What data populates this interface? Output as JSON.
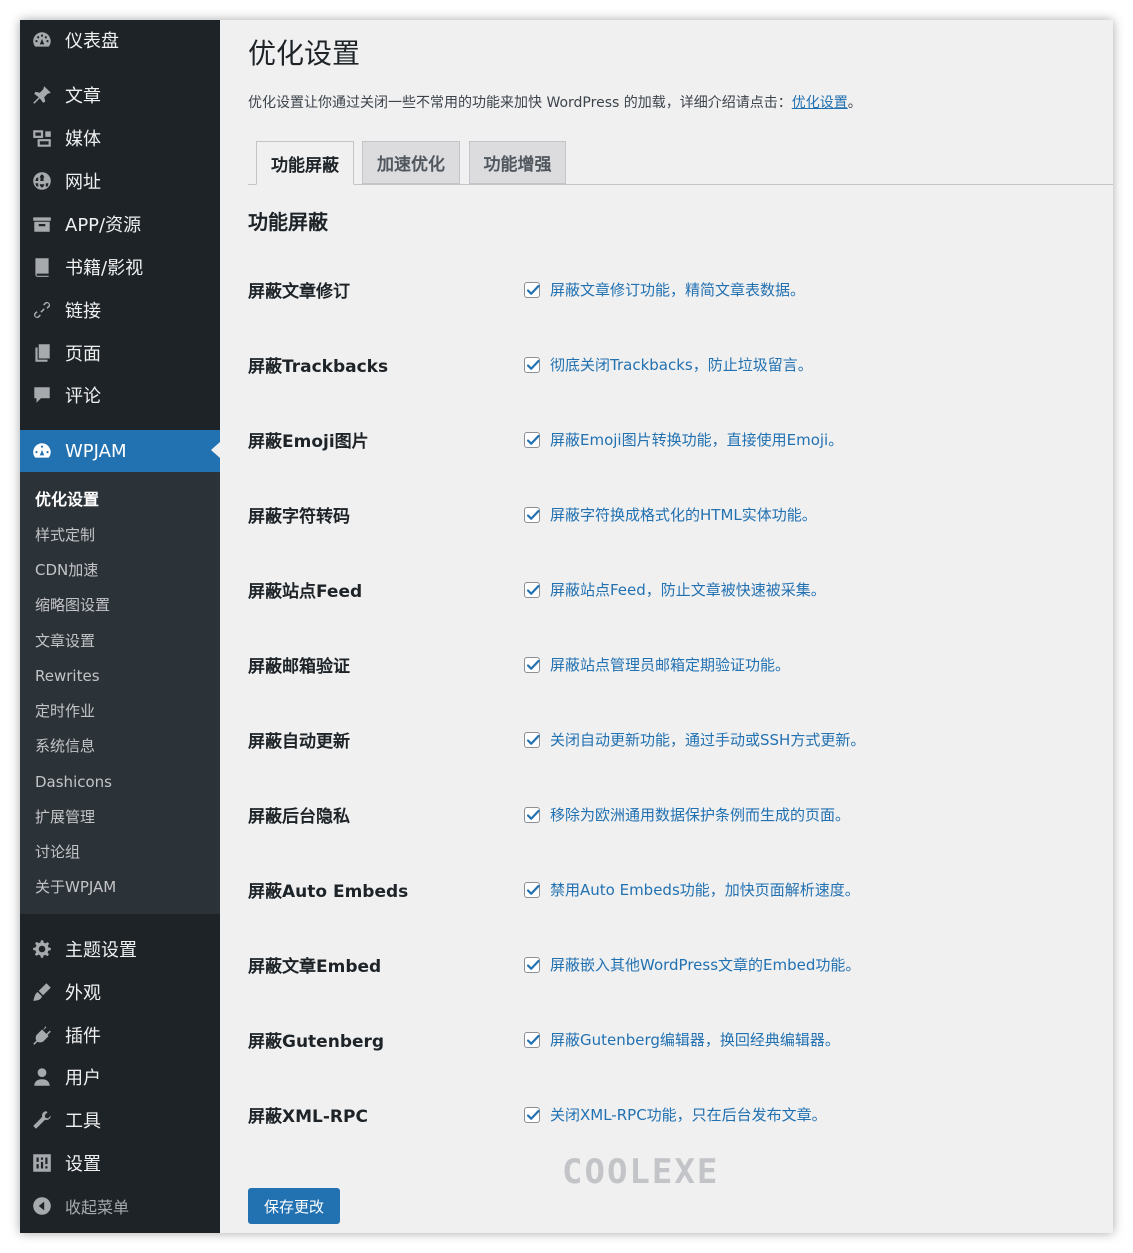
{
  "sidebar": {
    "items": [
      {
        "label": "仪表盘",
        "icon": "dashboard-icon"
      },
      {
        "label": "文章",
        "icon": "pin-icon"
      },
      {
        "label": "媒体",
        "icon": "media-icon"
      },
      {
        "label": "网址",
        "icon": "globe-icon"
      },
      {
        "label": "APP/资源",
        "icon": "archive-icon"
      },
      {
        "label": "书籍/影视",
        "icon": "book-icon"
      },
      {
        "label": "链接",
        "icon": "link-icon"
      },
      {
        "label": "页面",
        "icon": "page-icon"
      },
      {
        "label": "评论",
        "icon": "comment-icon"
      }
    ],
    "active": {
      "label": "WPJAM",
      "icon": "wpjam-gauge-icon"
    },
    "submenu": [
      "优化设置",
      "样式定制",
      "CDN加速",
      "缩略图设置",
      "文章设置",
      "Rewrites",
      "定时作业",
      "系统信息",
      "Dashicons",
      "扩展管理",
      "讨论组",
      "关于WPJAM"
    ],
    "bottom_items": [
      {
        "label": "主题设置",
        "icon": "gear-icon"
      },
      {
        "label": "外观",
        "icon": "brush-icon"
      },
      {
        "label": "插件",
        "icon": "plugin-icon"
      },
      {
        "label": "用户",
        "icon": "user-icon"
      },
      {
        "label": "工具",
        "icon": "wrench-icon"
      },
      {
        "label": "设置",
        "icon": "settings-icon"
      }
    ],
    "collapse_label": "收起菜单"
  },
  "main": {
    "title": "优化设置",
    "description": "优化设置让你通过关闭一些不常用的功能来加快 WordPress 的加载，详细介绍请点击：",
    "description_link": "优化设置",
    "description_end": "。",
    "tabs": [
      "功能屏蔽",
      "加速优化",
      "功能增强"
    ],
    "section_title": "功能屏蔽",
    "rows": [
      {
        "label": "屏蔽文章修订",
        "option": "屏蔽文章修订功能，精简文章表数据。",
        "checked": true
      },
      {
        "label": "屏蔽Trackbacks",
        "option": "彻底关闭Trackbacks，防止垃圾留言。",
        "checked": true
      },
      {
        "label": "屏蔽Emoji图片",
        "option": "屏蔽Emoji图片转换功能，直接使用Emoji。",
        "checked": true
      },
      {
        "label": "屏蔽字符转码",
        "option": "屏蔽字符换成格式化的HTML实体功能。",
        "checked": true
      },
      {
        "label": "屏蔽站点Feed",
        "option": "屏蔽站点Feed，防止文章被快速被采集。",
        "checked": true
      },
      {
        "label": "屏蔽邮箱验证",
        "option": "屏蔽站点管理员邮箱定期验证功能。",
        "checked": true
      },
      {
        "label": "屏蔽自动更新",
        "option": "关闭自动更新功能，通过手动或SSH方式更新。",
        "checked": true
      },
      {
        "label": "屏蔽后台隐私",
        "option": "移除为欧洲通用数据保护条例而生成的页面。",
        "checked": true
      },
      {
        "label": "屏蔽Auto Embeds",
        "option": "禁用Auto Embeds功能，加快页面解析速度。",
        "checked": true
      },
      {
        "label": "屏蔽文章Embed",
        "option": "屏蔽嵌入其他WordPress文章的Embed功能。",
        "checked": true
      },
      {
        "label": "屏蔽Gutenberg",
        "option": "屏蔽Gutenberg编辑器，换回经典编辑器。",
        "checked": true
      },
      {
        "label": "屏蔽XML-RPC",
        "option": "关闭XML-RPC功能，只在后台发布文章。",
        "checked": true
      }
    ],
    "watermark": "COOLEXE",
    "save_label": "保存更改"
  }
}
